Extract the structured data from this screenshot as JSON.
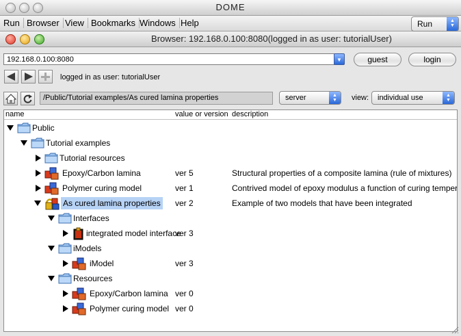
{
  "app": {
    "title": "DOME"
  },
  "menu": {
    "items": [
      "Run",
      "Browser",
      "View",
      "Bookmarks",
      "Windows",
      "Help"
    ],
    "run_select": "Run"
  },
  "browser": {
    "title": "Browser: 192.168.0.100:8080(logged in as user: tutorialUser)",
    "url": "192.168.0.100:8080",
    "guest_label": "guest",
    "login_label": "login",
    "status": "logged in as user: tutorialUser",
    "path": "/Public/Tutorial examples/As cured lamina properties",
    "location_select": "server",
    "view_label": "view:",
    "view_select": "individual use"
  },
  "tree": {
    "headers": {
      "name": "name",
      "version": "value or version",
      "description": "description"
    },
    "rows": [
      {
        "label": "Public",
        "version": "",
        "description": ""
      },
      {
        "label": "Tutorial examples",
        "version": "",
        "description": ""
      },
      {
        "label": "Tutorial resources",
        "version": "",
        "description": ""
      },
      {
        "label": "Epoxy/Carbon lamina",
        "version": "ver 5",
        "description": "Structural properties of a composite lamina (rule of mixtures)"
      },
      {
        "label": "Polymer curing model",
        "version": "ver 1",
        "description": "Contrived model  of epoxy modulus a function of curing temperature"
      },
      {
        "label": "As cured lamina properties",
        "version": "ver 2",
        "description": "Example of two models that have been integrated"
      },
      {
        "label": "Interfaces",
        "version": "",
        "description": ""
      },
      {
        "label": "integrated model interface",
        "version": "ver 3",
        "description": ""
      },
      {
        "label": "iModels",
        "version": "",
        "description": ""
      },
      {
        "label": "iModel",
        "version": "ver 3",
        "description": ""
      },
      {
        "label": "Resources",
        "version": "",
        "description": ""
      },
      {
        "label": "Epoxy/Carbon lamina",
        "version": "ver 0",
        "description": ""
      },
      {
        "label": "Polymer curing model",
        "version": "ver 0",
        "description": ""
      }
    ]
  }
}
